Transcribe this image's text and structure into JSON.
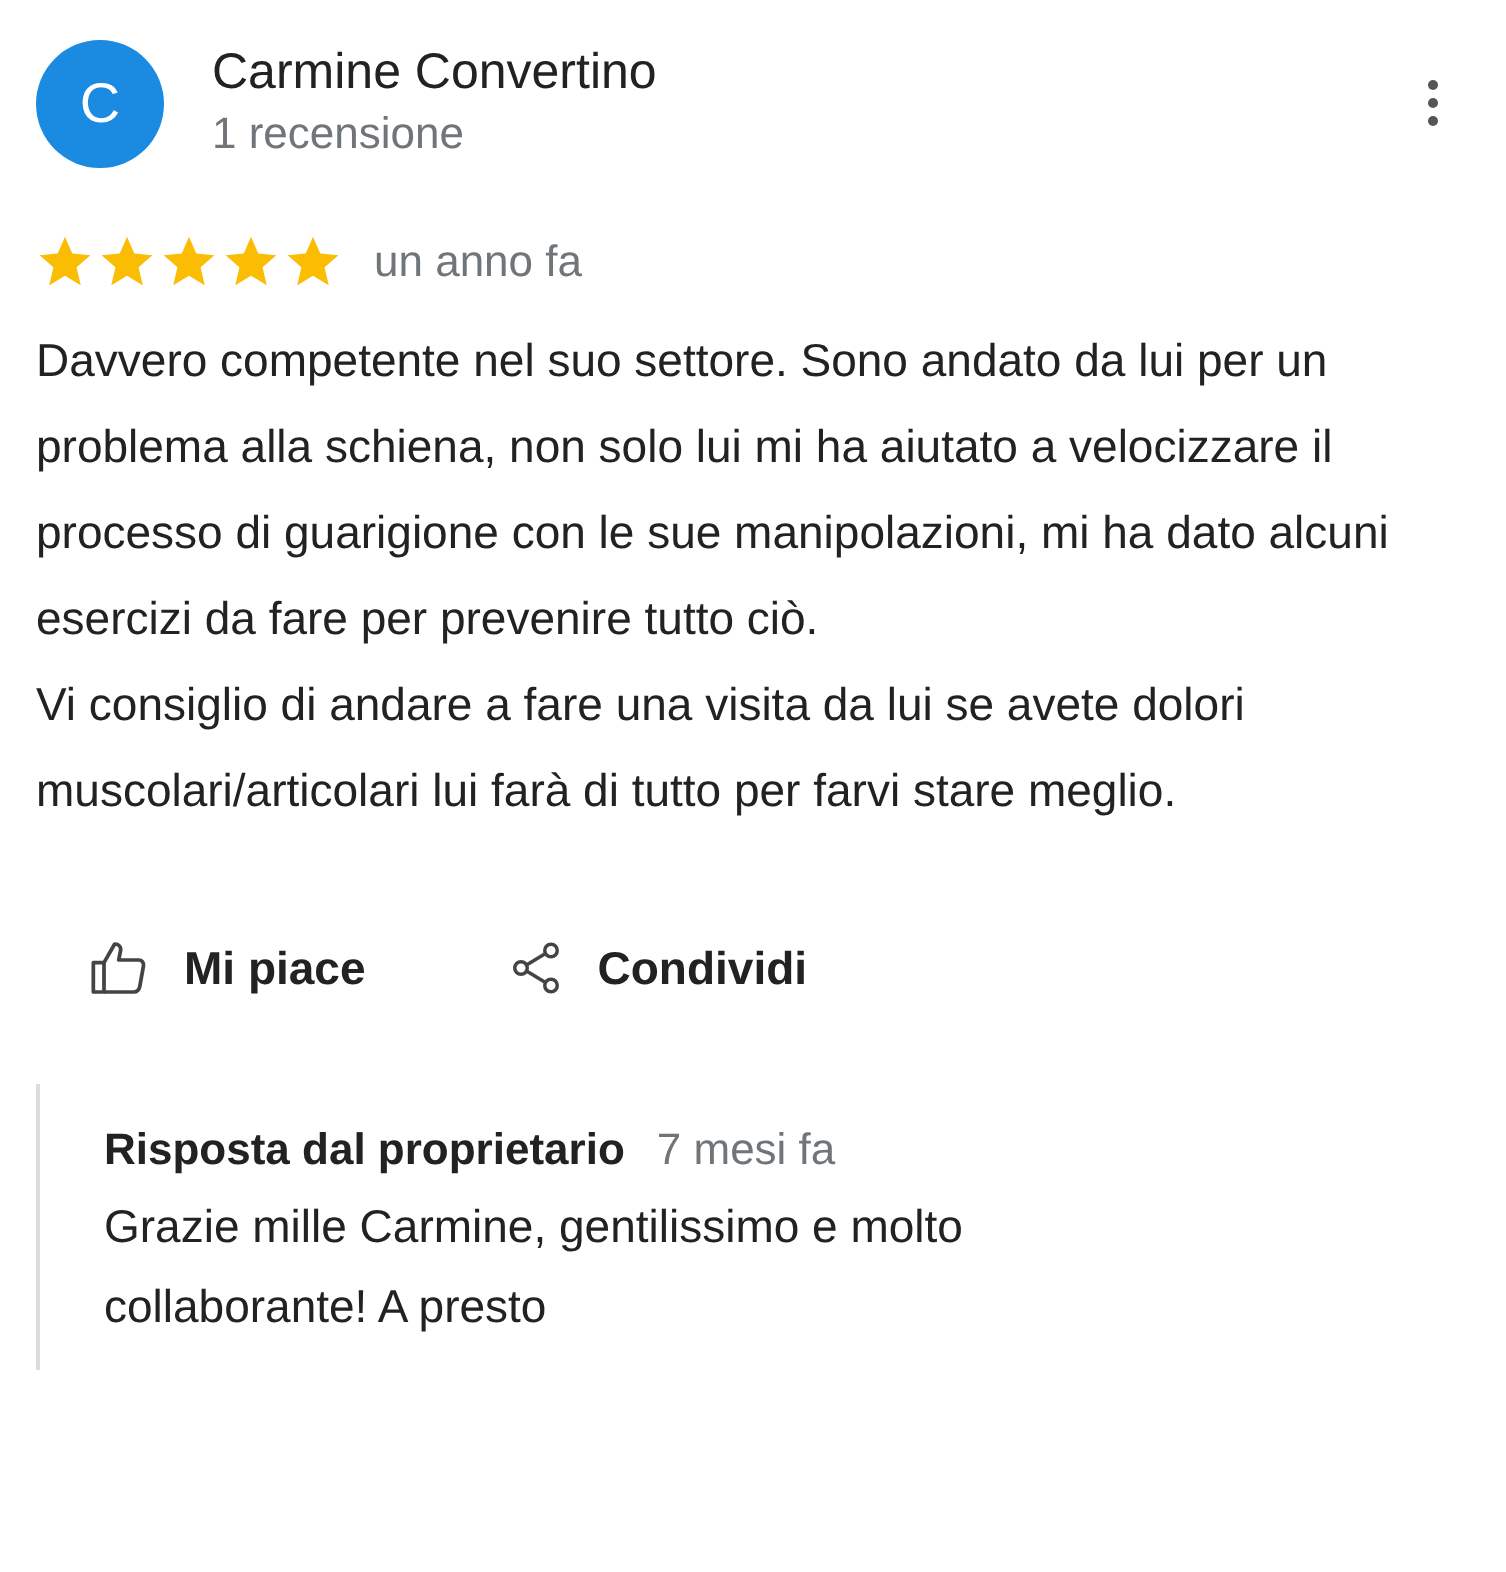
{
  "review": {
    "avatar_letter": "C",
    "author": "Carmine Convertino",
    "review_count": "1 recensione",
    "stars": 5,
    "time": "un anno fa",
    "paragraphs": [
      "Davvero competente nel suo settore. Sono andato da lui per un problema alla schiena, non solo lui mi ha aiutato a velocizzare il processo di guarigione con le sue manipolazioni, mi ha dato alcuni esercizi da fare per prevenire tutto ciò.",
      "Vi consiglio di andare a fare una visita da lui se avete dolori muscolari/articolari lui farà di tutto per farvi stare meglio."
    ]
  },
  "actions": [
    {
      "kind": "like",
      "label": "Mi piace"
    },
    {
      "kind": "share",
      "label": "Condividi"
    }
  ],
  "owner_reply": {
    "title": "Risposta dal proprietario",
    "time": "7 mesi fa",
    "text": "Grazie mille Carmine, gentilissimo e molto collaborante! A presto"
  }
}
